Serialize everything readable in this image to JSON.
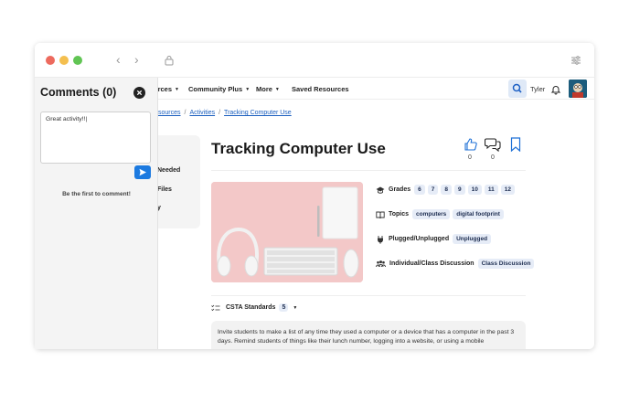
{
  "browser": {
    "icons": [
      "back-arrow-icon",
      "forward-arrow-icon",
      "lock-icon",
      "tune-icon"
    ]
  },
  "nav": {
    "items": [
      {
        "label": "urces",
        "caret": true
      },
      {
        "label": "Community Plus",
        "caret": true
      },
      {
        "label": "More",
        "caret": true
      },
      {
        "label": "Saved Resources",
        "caret": false
      }
    ],
    "user": "Tyler"
  },
  "breadcrumb": {
    "items": [
      "sources",
      "Activities",
      "Tracking Computer Use"
    ]
  },
  "left_menu": {
    "items": [
      "Needed",
      "Files",
      "y"
    ]
  },
  "activity": {
    "title": "Tracking Computer Use",
    "likes": "0",
    "comments": "0",
    "meta": [
      {
        "label": "Grades",
        "tags": [
          "6",
          "7",
          "8",
          "9",
          "10",
          "11",
          "12"
        ]
      },
      {
        "label": "Topics",
        "tags": [
          "computers",
          "digital footprint"
        ]
      },
      {
        "label": "Plugged/Unplugged",
        "tags": [
          "Unplugged"
        ]
      },
      {
        "label": "Individual/Class Discussion",
        "tags": [
          "Class Discussion"
        ]
      }
    ],
    "standards": {
      "label": "CSTA Standards",
      "count": "5"
    },
    "description": "Invite students to make a list of any time they used a computer or a device that has a computer in the past 3 days. Remind students of things like their lunch number, logging into a website, or using a mobile"
  },
  "comments_panel": {
    "title": "Comments (0)",
    "input_value": "Great activity!!|",
    "empty_message": "Be the first to comment!"
  },
  "colors": {
    "accent": "#1c7ae0",
    "tag_bg": "#e6ecf7",
    "photo_bg": "#f3c8c8"
  }
}
